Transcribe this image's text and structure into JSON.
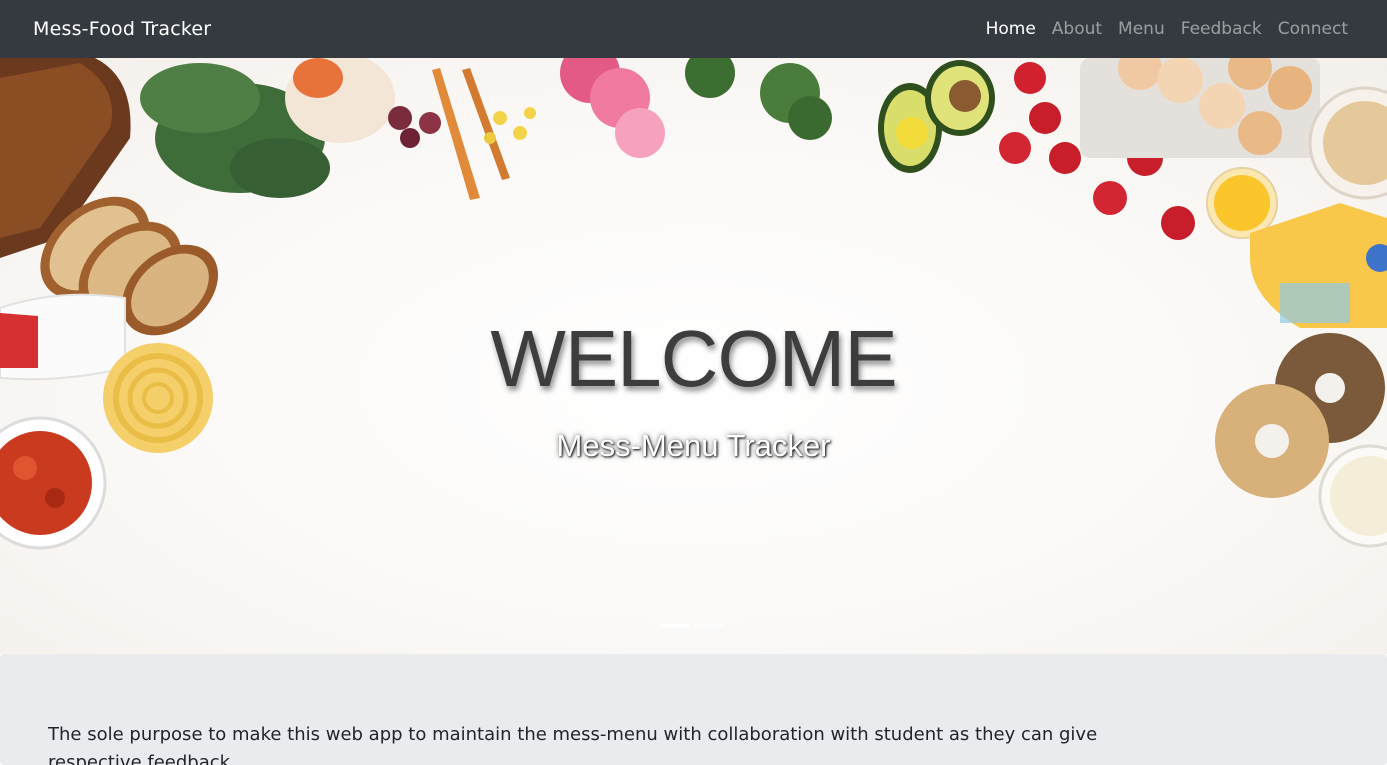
{
  "navbar": {
    "brand": "Mess-Food Tracker",
    "links": [
      {
        "label": "Home",
        "active": true
      },
      {
        "label": "About",
        "active": false
      },
      {
        "label": "Menu",
        "active": false
      },
      {
        "label": "Feedback",
        "active": false
      },
      {
        "label": "Connect",
        "active": false
      }
    ]
  },
  "hero": {
    "title": "WELCOME",
    "subtitle": "Mess-Menu Tracker",
    "carousel_slides": 2,
    "active_slide": 1
  },
  "about": {
    "text": "The sole purpose to make this web app to maintain the mess-menu with collaboration with student as they can give respective feedback"
  },
  "colors": {
    "navbar_bg": "#343a40",
    "about_bg": "#e9ecef",
    "title_color": "#3d3d3d"
  }
}
